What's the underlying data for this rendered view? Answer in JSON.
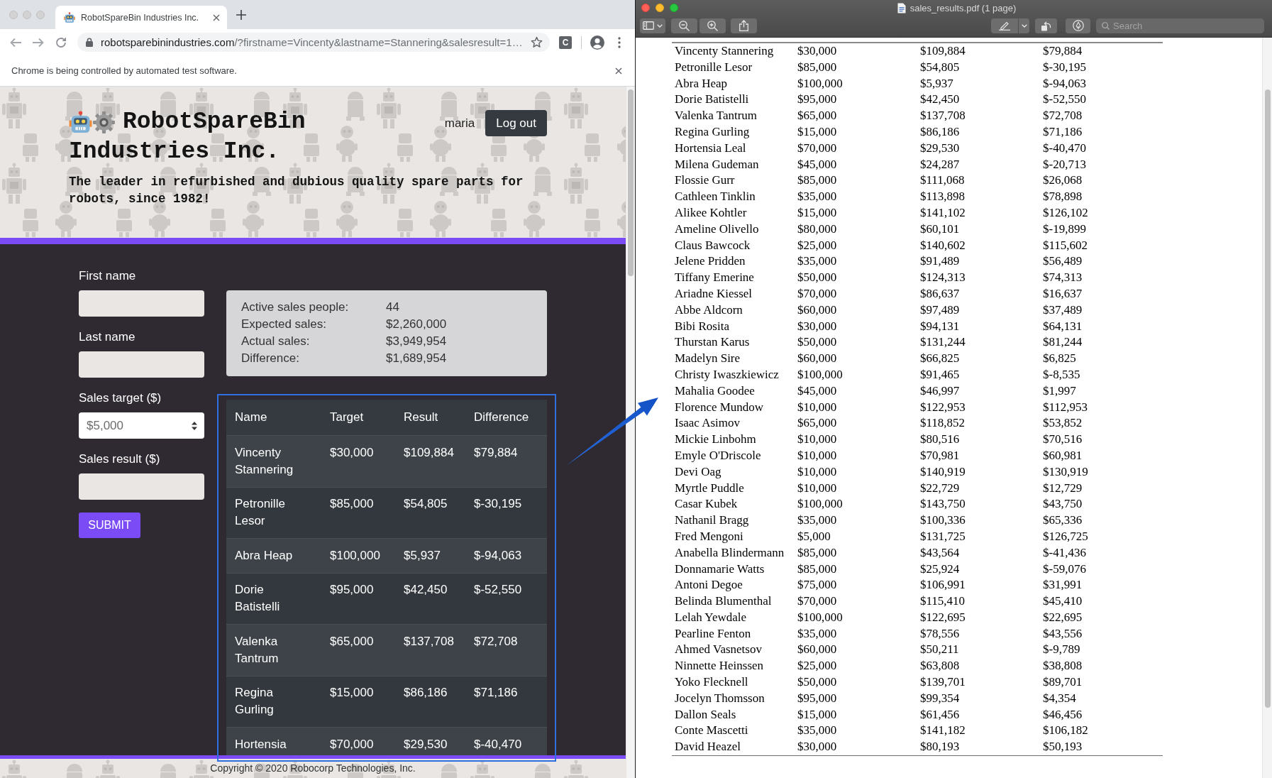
{
  "browser": {
    "tabs": [
      {
        "title": "RobotSpareBin Industries Inc.",
        "selected": true
      }
    ],
    "address": {
      "host": "robotsparebinindustries.com",
      "path": "/?firstname=Vincenty&lastname=Stannering&salesresult=1…"
    },
    "extension_label": "C",
    "infobar": "Chrome is being controlled by automated test software."
  },
  "site": {
    "title_lines": [
      "RobotSpareBin",
      "Industries Inc."
    ],
    "tagline": "The leader in refurbished and dubious quality spare parts for robots, since 1982!",
    "user": "maria",
    "logout_button": "Log out",
    "form": {
      "fields": [
        {
          "kind": "text",
          "label": "First name"
        },
        {
          "kind": "text",
          "label": "Last name"
        },
        {
          "kind": "select",
          "label": "Sales target ($)",
          "value": "$5,000"
        },
        {
          "kind": "text",
          "label": "Sales result ($)"
        }
      ],
      "submit_button": "SUBMIT"
    },
    "summary": [
      {
        "label": "Active sales people:",
        "value": "44"
      },
      {
        "label": "Expected sales:",
        "value": "$2,260,000"
      },
      {
        "label": "Actual sales:",
        "value": "$3,949,954"
      },
      {
        "label": "Difference:",
        "value": "$1,689,954"
      }
    ],
    "table": {
      "columns": [
        "Name",
        "Target",
        "Result",
        "Difference"
      ],
      "rows": [
        [
          "Vincenty Stannering",
          "$30,000",
          "$109,884",
          "$79,884"
        ],
        [
          "Petronille Lesor",
          "$85,000",
          "$54,805",
          "$-30,195"
        ],
        [
          "Abra Heap",
          "$100,000",
          "$5,937",
          "$-94,063"
        ],
        [
          "Dorie Batistelli",
          "$95,000",
          "$42,450",
          "$-52,550"
        ],
        [
          "Valenka Tantrum",
          "$65,000",
          "$137,708",
          "$72,708"
        ],
        [
          "Regina Gurling",
          "$15,000",
          "$86,186",
          "$71,186"
        ],
        [
          "Hortensia",
          "$70,000",
          "$29,530",
          "$-40,470"
        ]
      ]
    },
    "footer": "Copyright © 2020 Robocorp Technologies, Inc."
  },
  "preview": {
    "title": "sales_results.pdf (1 page)",
    "search": {
      "placeholder": "Search"
    },
    "table": {
      "rows": [
        [
          "Vincenty Stannering",
          "$30,000",
          "$109,884",
          "$79,884"
        ],
        [
          "Petronille Lesor",
          "$85,000",
          "$54,805",
          "$-30,195"
        ],
        [
          "Abra Heap",
          "$100,000",
          "$5,937",
          "$-94,063"
        ],
        [
          "Dorie Batistelli",
          "$95,000",
          "$42,450",
          "$-52,550"
        ],
        [
          "Valenka Tantrum",
          "$65,000",
          "$137,708",
          "$72,708"
        ],
        [
          "Regina Gurling",
          "$15,000",
          "$86,186",
          "$71,186"
        ],
        [
          "Hortensia Leal",
          "$70,000",
          "$29,530",
          "$-40,470"
        ],
        [
          "Milena Gudeman",
          "$45,000",
          "$24,287",
          "$-20,713"
        ],
        [
          "Flossie Gurr",
          "$85,000",
          "$111,068",
          "$26,068"
        ],
        [
          "Cathleen Tinklin",
          "$35,000",
          "$113,898",
          "$78,898"
        ],
        [
          "Alikee Kohtler",
          "$15,000",
          "$141,102",
          "$126,102"
        ],
        [
          "Ameline Olivello",
          "$80,000",
          "$60,101",
          "$-19,899"
        ],
        [
          "Claus Bawcock",
          "$25,000",
          "$140,602",
          "$115,602"
        ],
        [
          "Jelene Pridden",
          "$35,000",
          "$91,489",
          "$56,489"
        ],
        [
          "Tiffany Emerine",
          "$50,000",
          "$124,313",
          "$74,313"
        ],
        [
          "Ariadne Kiessel",
          "$70,000",
          "$86,637",
          "$16,637"
        ],
        [
          "Abbe Aldcorn",
          "$60,000",
          "$97,489",
          "$37,489"
        ],
        [
          "Bibi Rosita",
          "$30,000",
          "$94,131",
          "$64,131"
        ],
        [
          "Thurstan Karus",
          "$50,000",
          "$131,244",
          "$81,244"
        ],
        [
          "Madelyn Sire",
          "$60,000",
          "$66,825",
          "$6,825"
        ],
        [
          "Christy Iwaszkiewicz",
          "$100,000",
          "$91,465",
          "$-8,535"
        ],
        [
          "Mahalia Goodee",
          "$45,000",
          "$46,997",
          "$1,997"
        ],
        [
          "Florence Mundow",
          "$10,000",
          "$122,953",
          "$112,953"
        ],
        [
          "Isaac Asimov",
          "$65,000",
          "$118,852",
          "$53,852"
        ],
        [
          "Mickie Linbohm",
          "$10,000",
          "$80,516",
          "$70,516"
        ],
        [
          "Emyle O'Driscole",
          "$10,000",
          "$70,981",
          "$60,981"
        ],
        [
          "Devi Oag",
          "$10,000",
          "$140,919",
          "$130,919"
        ],
        [
          "Myrtle Puddle",
          "$10,000",
          "$22,729",
          "$12,729"
        ],
        [
          "Casar Kubek",
          "$100,000",
          "$143,750",
          "$43,750"
        ],
        [
          "Nathanil Bragg",
          "$35,000",
          "$100,336",
          "$65,336"
        ],
        [
          "Fred Mengoni",
          "$5,000",
          "$131,725",
          "$126,725"
        ],
        [
          "Anabella Blindermann",
          "$85,000",
          "$43,564",
          "$-41,436"
        ],
        [
          "Donnamarie Watts",
          "$85,000",
          "$25,924",
          "$-59,076"
        ],
        [
          "Antoni Degoe",
          "$75,000",
          "$106,991",
          "$31,991"
        ],
        [
          "Belinda Blumenthal",
          "$70,000",
          "$115,410",
          "$45,410"
        ],
        [
          "Lelah Yewdale",
          "$100,000",
          "$122,695",
          "$22,695"
        ],
        [
          "Pearline Fenton",
          "$35,000",
          "$78,556",
          "$43,556"
        ],
        [
          "Ahmed Vasnetsov",
          "$60,000",
          "$50,211",
          "$-9,789"
        ],
        [
          "Ninnette Heinssen",
          "$25,000",
          "$63,808",
          "$38,808"
        ],
        [
          "Yoko Flecknell",
          "$50,000",
          "$139,701",
          "$89,701"
        ],
        [
          "Jocelyn Thomsson",
          "$95,000",
          "$99,354",
          "$4,354"
        ],
        [
          "Dallon Seals",
          "$15,000",
          "$61,456",
          "$46,456"
        ],
        [
          "Conte Mascetti",
          "$35,000",
          "$141,182",
          "$106,182"
        ],
        [
          "David Heazel",
          "$30,000",
          "$80,193",
          "$50,193"
        ]
      ]
    }
  }
}
